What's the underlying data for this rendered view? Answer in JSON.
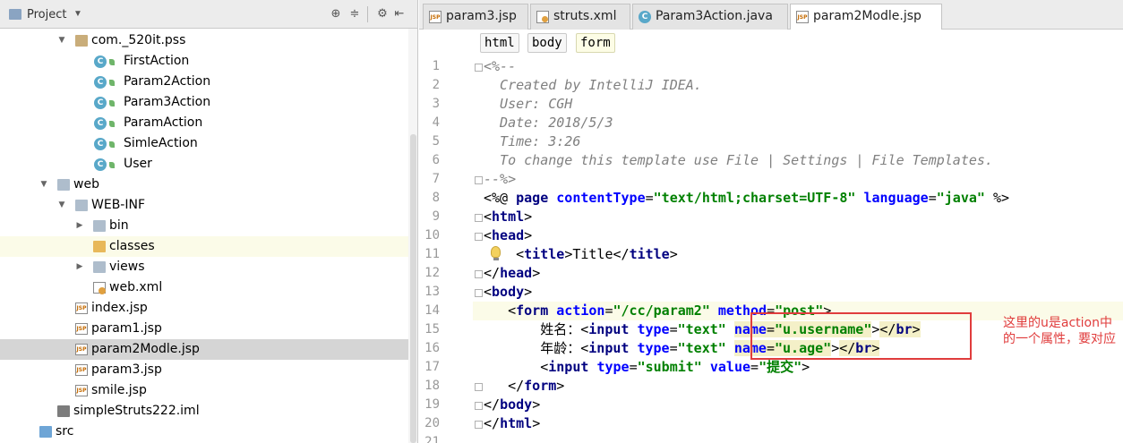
{
  "project_panel": {
    "title": "Project",
    "tree": [
      {
        "label": "com._520it.pss",
        "icon": "package-icon",
        "expanded": true
      },
      {
        "label": "FirstAction",
        "icon": "class-icon"
      },
      {
        "label": "Param2Action",
        "icon": "class-icon"
      },
      {
        "label": "Param3Action",
        "icon": "class-icon"
      },
      {
        "label": "ParamAction",
        "icon": "class-icon"
      },
      {
        "label": "SimleAction",
        "icon": "class-icon"
      },
      {
        "label": "User",
        "icon": "class-icon"
      },
      {
        "label": "web",
        "icon": "folder-icon",
        "expanded": true
      },
      {
        "label": "WEB-INF",
        "icon": "folder-icon",
        "expanded": true
      },
      {
        "label": "bin",
        "icon": "folder-icon",
        "expanded": false
      },
      {
        "label": "classes",
        "icon": "folder-yellow-icon"
      },
      {
        "label": "views",
        "icon": "folder-icon",
        "expanded": false
      },
      {
        "label": "web.xml",
        "icon": "xml-file-icon"
      },
      {
        "label": "index.jsp",
        "icon": "jsp-file-icon"
      },
      {
        "label": "param1.jsp",
        "icon": "jsp-file-icon"
      },
      {
        "label": "param2Modle.jsp",
        "icon": "jsp-file-icon",
        "selected": true
      },
      {
        "label": "param3.jsp",
        "icon": "jsp-file-icon"
      },
      {
        "label": "smile.jsp",
        "icon": "jsp-file-icon"
      },
      {
        "label": "simpleStruts222.iml",
        "icon": "iml-file-icon"
      },
      {
        "label": "src",
        "icon": "src-folder-icon"
      }
    ]
  },
  "tabs": [
    {
      "label": "param3.jsp",
      "icon": "jsp-file-icon"
    },
    {
      "label": "struts.xml",
      "icon": "xml-file-icon"
    },
    {
      "label": "Param3Action.java",
      "icon": "class-icon"
    },
    {
      "label": "param2Modle.jsp",
      "icon": "jsp-file-icon",
      "active": true
    }
  ],
  "jsp_badge": "JSP",
  "class_badge": "C",
  "breadcrumbs": [
    "html",
    "body",
    "form"
  ],
  "gutter": {
    "line_numbers": [
      "1",
      "2",
      "3",
      "4",
      "5",
      "6",
      "7",
      "8",
      "9",
      "10",
      "11",
      "12",
      "13",
      "14",
      "15",
      "16",
      "17",
      "18",
      "19",
      "20",
      "21"
    ]
  },
  "code": {
    "l1": "<%--",
    "l2": "  Created by IntelliJ IDEA.",
    "l3": "  User: CGH",
    "l4": "  Date: 2018/5/3",
    "l5": "  Time: 3:26",
    "l6": "  To change this template use File | Settings | File Templates.",
    "l7": "--%>",
    "l8": {
      "open": "<%@ ",
      "directive": "page",
      "a1": "contentType",
      "eq": "=",
      "v1": "\"text/html;charset=UTF-8\"",
      "a2": "language",
      "v2": "\"java\"",
      "close": " %>"
    },
    "l9": "html",
    "l10": "head",
    "l11": {
      "tag": "title",
      "text": "Title"
    },
    "l12": "head",
    "l13": "body",
    "l14": {
      "tag": "form",
      "a1": "action",
      "v1": "\"/cc/param2\"",
      "a2": "method",
      "v2": "\"post\""
    },
    "l15": {
      "label": "姓名：",
      "tag": "input",
      "a1": "type",
      "v1": "\"text\"",
      "a2": "name",
      "v2": "\"u.username\"",
      "br": "br"
    },
    "l16": {
      "label": "年龄：",
      "tag": "input",
      "a1": "type",
      "v1": "\"text\"",
      "a2": "name",
      "v2": "\"u.age\"",
      "br": "br"
    },
    "l17": {
      "tag": "input",
      "a1": "type",
      "v1": "\"submit\"",
      "a2": "value",
      "v2": "\"提交\""
    },
    "l18": "form",
    "l19": "body",
    "l20": "html"
  },
  "annotation_note": "这里的u是action中的一个属性，要对应",
  "colors": {
    "annotation": "#e03c3c",
    "tag": "#000080",
    "attribute": "#0000ff",
    "string": "#008000",
    "comment": "#808080",
    "selection": "#d5d5d5"
  }
}
